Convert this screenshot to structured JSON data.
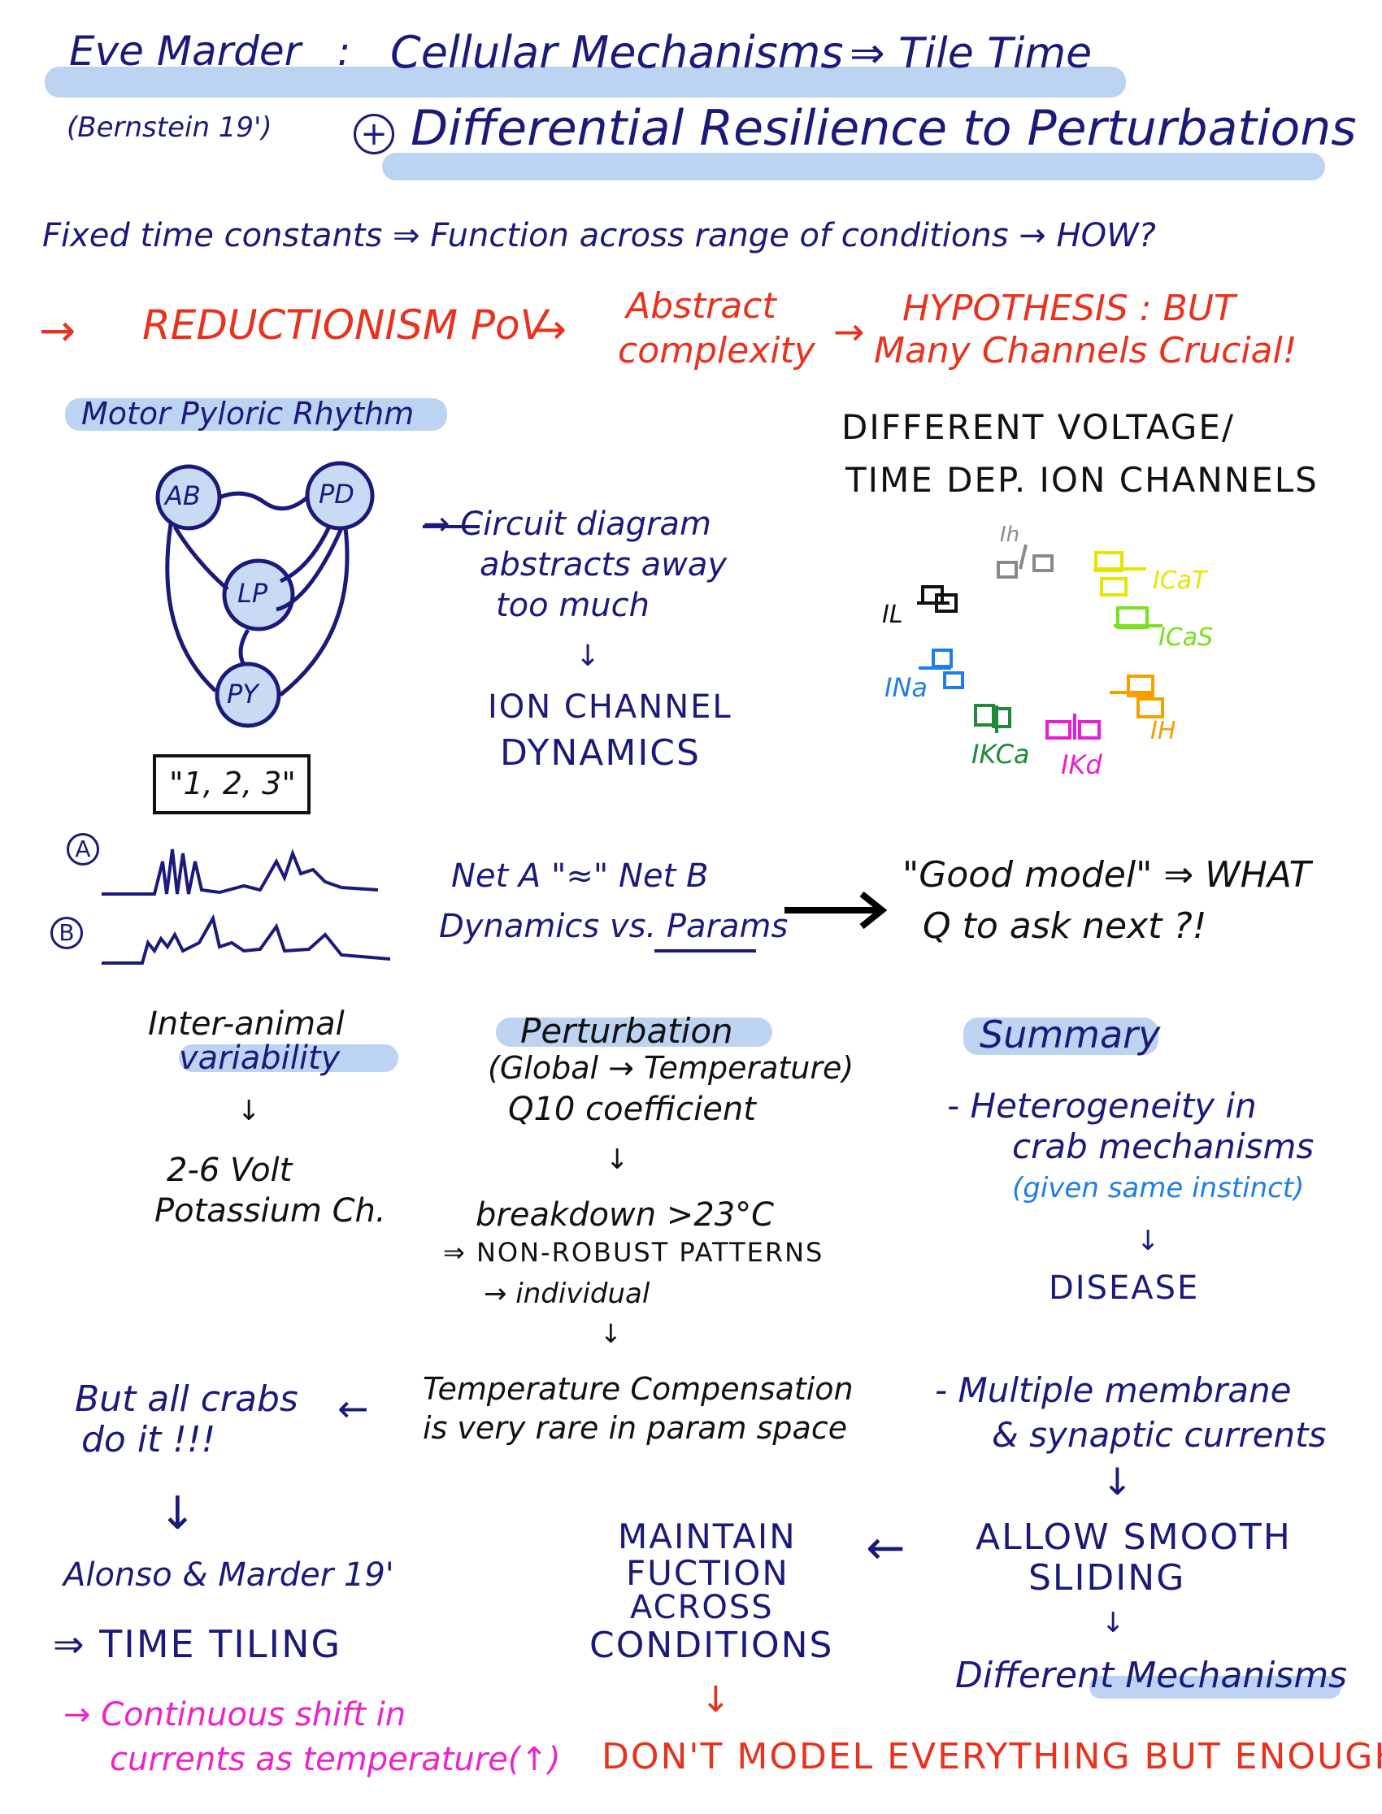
{
  "header": {
    "author": "Eve Marder",
    "colon": ":",
    "title": "Cellular Mechanisms",
    "title_suffix": "⇒ Tile Time",
    "citation": "(Bernstein 19')",
    "subtitle_plus": "+",
    "subtitle": "Differential Resilience to Perturbations"
  },
  "intro": {
    "question": "Fixed time constants ⇒ Function across range of conditions → HOW?",
    "red_line": {
      "arrow": "→",
      "reductionism": "REDUCTIONISM PoV",
      "arrow2": "→",
      "abstract_l1": "Abstract",
      "abstract_l2": "complexity",
      "arrow3": "→",
      "hyp_l1": "HYPOTHESIS : BUT",
      "hyp_l2": "Many Channels Crucial!"
    }
  },
  "pyloric": {
    "label": "Motor Pyloric Rhythm",
    "nodes": {
      "ab": "AB",
      "pd": "PD",
      "lp": "LP",
      "py": "PY"
    },
    "sequence": "\"1, 2, 3\"",
    "circuit_note_l1": "→ Circuit diagram",
    "circuit_note_l2": "abstracts away",
    "circuit_note_l3": "too much",
    "down": "↓",
    "ion_l1": "ION CHANNEL",
    "ion_l2": "DYNAMICS"
  },
  "channels": {
    "title_l1": "DIFFERENT VOLTAGE/",
    "title_l2": "TIME DEP. ION CHANNELS",
    "items": [
      {
        "label": "Ih",
        "color": "#8a8a8a"
      },
      {
        "label": "IL",
        "color": "#111111"
      },
      {
        "label": "ICaT",
        "color": "#e3e600"
      },
      {
        "label": "ICaS",
        "color": "#7ae01b"
      },
      {
        "label": "INa",
        "color": "#1e7fe6"
      },
      {
        "label": "IKCa",
        "color": "#1e8a3a"
      },
      {
        "label": "IKd",
        "color": "#e81fd0"
      },
      {
        "label": "IH",
        "color": "#f5a000"
      }
    ]
  },
  "traces": {
    "a": "A",
    "b": "B",
    "net_l1": "Net A \"≈\" Net B",
    "net_l2": "Dynamics vs. Params",
    "good_l1": "\"Good model\" ⇒ WHAT",
    "good_l2": "Q to ask next ?!"
  },
  "variability": {
    "l1": "Inter-animal",
    "l2": "variability",
    "down": "↓",
    "r1": "2-6 Volt",
    "r2": "Potassium Ch."
  },
  "perturbation": {
    "title": "Perturbation",
    "l1": "(Global → Temperature)",
    "l2": "Q10 coefficient",
    "down": "↓",
    "breakdown": "breakdown >23°C",
    "nonrobust": "⇒ NON-ROBUST PATTERNS",
    "individual": "→ individual",
    "down2": "↓",
    "comp_l1": "Temperature Compensation",
    "comp_l2": "is very rare in param space"
  },
  "crabs": {
    "l1": "But all crabs",
    "l2": "do it !!!",
    "arrow": "←",
    "down": "↓",
    "alonso": "Alonso & Marder 19'",
    "tiling": "⇒ TIME TILING",
    "shift_l1": "→ Continuous shift in",
    "shift_l2": "currents as temperature(↑)"
  },
  "summary": {
    "title": "Summary",
    "b1_l1": "- Heterogeneity in",
    "b1_l2": "crab mechanisms",
    "b1_l3": "(given same instinct)",
    "down": "↓",
    "disease": "DISEASE",
    "b2_l1": "- Multiple membrane",
    "b2_l2": "& synaptic currents",
    "down2": "↓",
    "sliding_l1": "ALLOW SMOOTH",
    "sliding_l2": "SLIDING",
    "down3": "↓",
    "diff_mech": "Different Mechanisms",
    "arrow_left": "←",
    "maintain_l1": "MAINTAIN",
    "maintain_l2": "FUCTION",
    "maintain_l3": "ACROSS",
    "maintain_l4": "CONDITIONS",
    "down4": "↓",
    "conclusion": "DON'T MODEL EVERYTHING BUT ENOUGH"
  }
}
